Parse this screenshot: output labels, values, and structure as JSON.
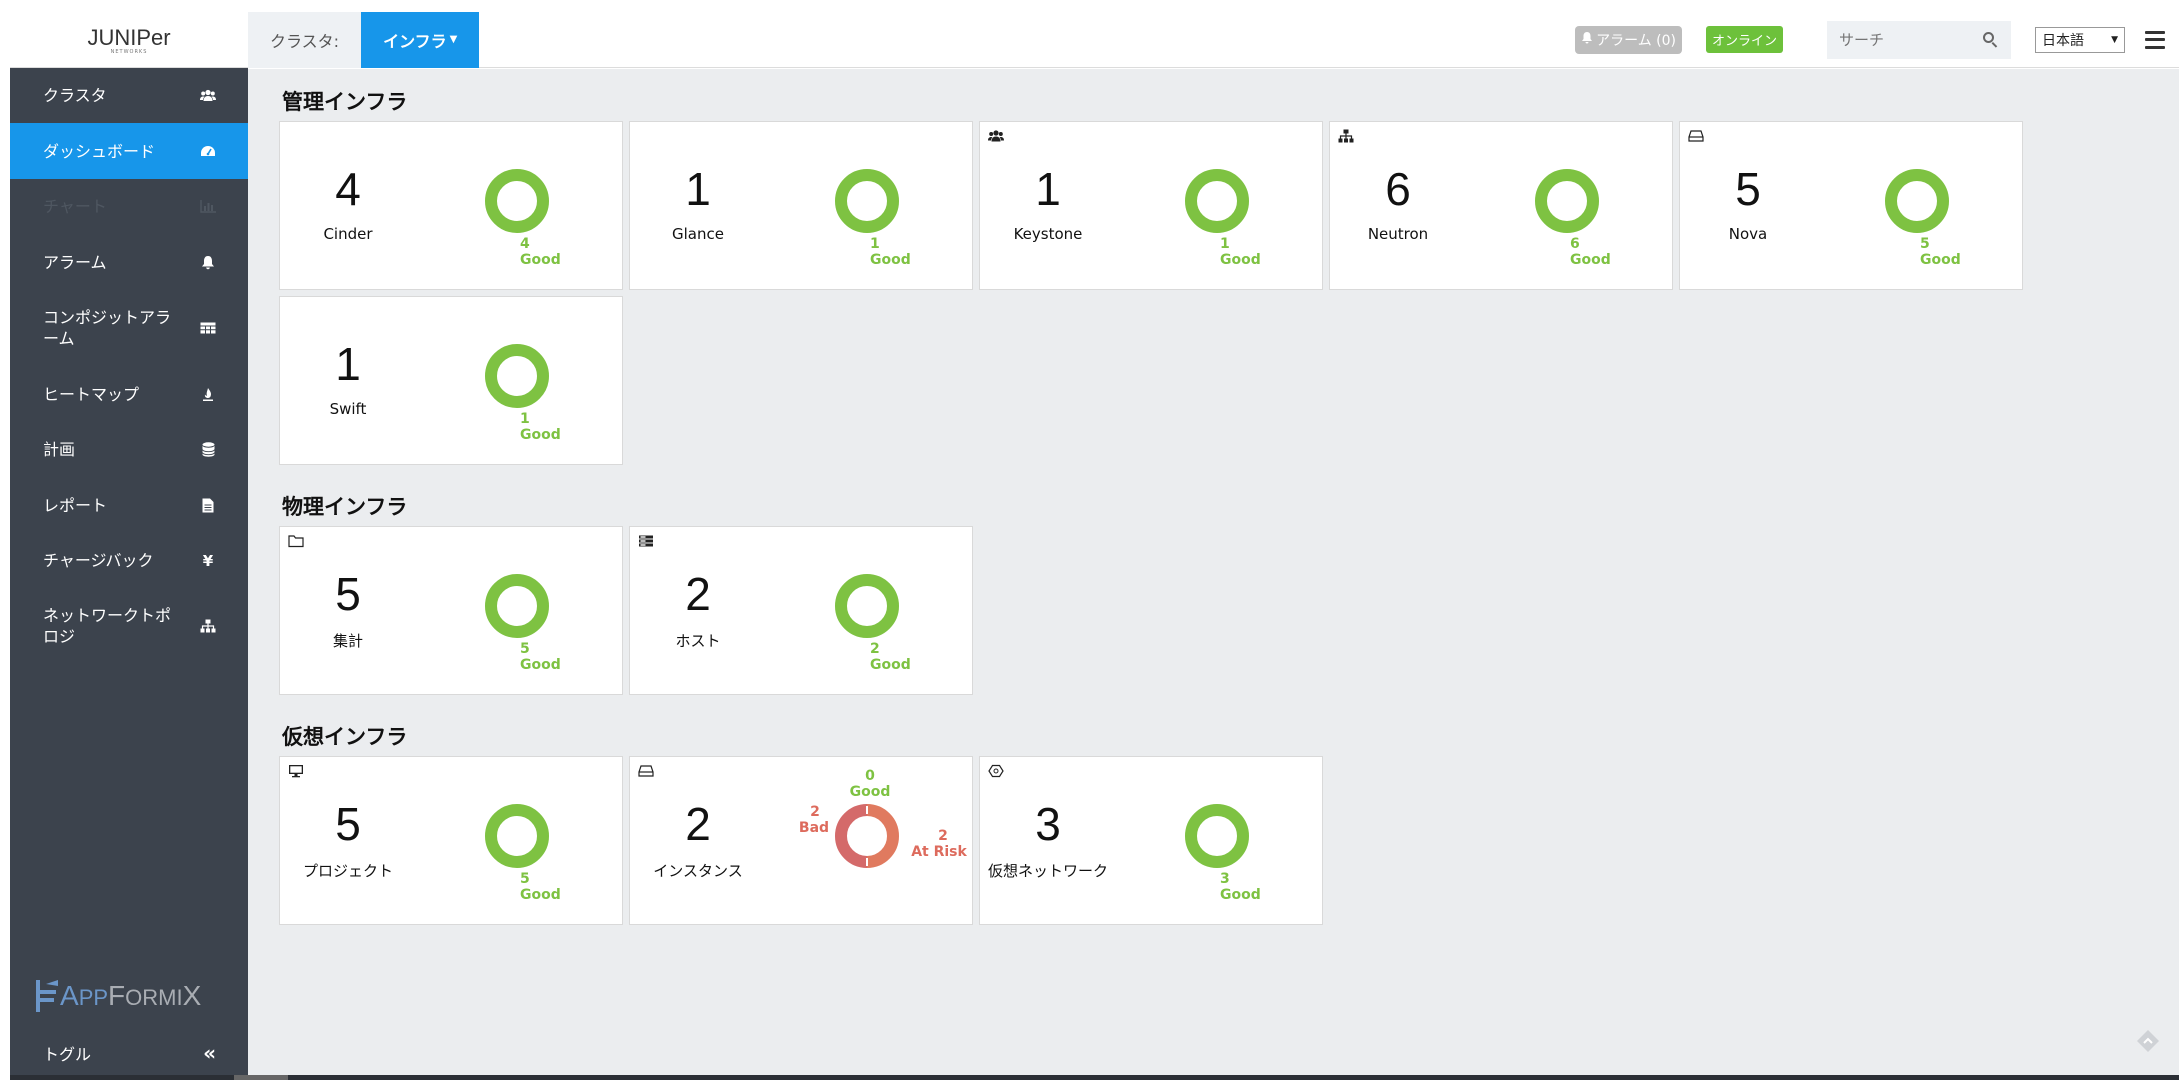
{
  "header": {
    "logo": "JUNIPer",
    "logo_sub": "NETWORKS",
    "breadcrumb_label": "クラスタ:",
    "breadcrumb_active": "インフラ",
    "alarm_label": "アラーム (0)",
    "online_label": "オンライン",
    "search_placeholder": "サーチ",
    "language": "日本語"
  },
  "sidebar": {
    "items": [
      {
        "label": "クラスタ",
        "icon": "users-icon"
      },
      {
        "label": "ダッシュボード",
        "icon": "dashboard-icon"
      },
      {
        "label": "チャート",
        "icon": "bar-chart-icon"
      },
      {
        "label": "アラーム",
        "icon": "bell-icon"
      },
      {
        "label": "コンポジットアラーム",
        "icon": "table-icon"
      },
      {
        "label": "ヒートマップ",
        "icon": "flame-icon"
      },
      {
        "label": "計画",
        "icon": "database-icon"
      },
      {
        "label": "レポート",
        "icon": "file-icon"
      },
      {
        "label": "チャージバック",
        "icon": "yen-icon"
      },
      {
        "label": "ネットワークトポロジ",
        "icon": "sitemap-icon"
      }
    ],
    "brand_a": "A",
    "brand_pp": "PP",
    "brand_f": "F",
    "brand_ormi": "ORMI",
    "brand_x": "X",
    "toggle_label": "トグル",
    "toggle_icon": "double-chevron-left-icon"
  },
  "sections": {
    "management": "管理インフラ",
    "physical": "物理インフラ",
    "virtual": "仮想インフラ"
  },
  "cards": {
    "cinder": {
      "count": "4",
      "name": "Cinder",
      "good_count": "4",
      "good_label": "Good",
      "health": {
        "good": 4
      }
    },
    "glance": {
      "count": "1",
      "name": "Glance",
      "good_count": "1",
      "good_label": "Good",
      "health": {
        "good": 1
      }
    },
    "keystone": {
      "count": "1",
      "name": "Keystone",
      "good_count": "1",
      "good_label": "Good",
      "icon": "users-icon",
      "health": {
        "good": 1
      }
    },
    "neutron": {
      "count": "6",
      "name": "Neutron",
      "good_count": "6",
      "good_label": "Good",
      "icon": "sitemap-icon",
      "health": {
        "good": 6
      }
    },
    "nova": {
      "count": "5",
      "name": "Nova",
      "good_count": "5",
      "good_label": "Good",
      "icon": "drive-icon",
      "health": {
        "good": 5
      }
    },
    "swift": {
      "count": "1",
      "name": "Swift",
      "good_count": "1",
      "good_label": "Good",
      "health": {
        "good": 1
      }
    },
    "aggregate": {
      "count": "5",
      "name": "集計",
      "good_count": "5",
      "good_label": "Good",
      "icon": "folder-icon",
      "health": {
        "good": 5
      }
    },
    "host": {
      "count": "2",
      "name": "ホスト",
      "good_count": "2",
      "good_label": "Good",
      "icon": "server-icon",
      "health": {
        "good": 2
      }
    },
    "project": {
      "count": "5",
      "name": "プロジェクト",
      "good_count": "5",
      "good_label": "Good",
      "icon": "monitor-icon",
      "health": {
        "good": 5
      }
    },
    "instance": {
      "count": "2",
      "name": "インスタンス",
      "icon": "drive-icon",
      "good_count": "0",
      "good_label": "Good",
      "bad_count": "2",
      "bad_label": "Bad",
      "risk_count": "2",
      "risk_label": "At Risk",
      "health": {
        "good": 0,
        "bad": 2,
        "at_risk": 2
      }
    },
    "vnetwork": {
      "count": "3",
      "name": "仮想ネットワーク",
      "good_count": "3",
      "good_label": "Good",
      "icon": "hexagon-icon",
      "health": {
        "good": 3
      }
    }
  },
  "colors": {
    "accent": "#1796ea",
    "sidebar_bg": "#3c434d",
    "good": "#7ec242",
    "bad": "#dd6b5d",
    "at_risk": "#e07a5f",
    "online": "#6dc13b"
  }
}
